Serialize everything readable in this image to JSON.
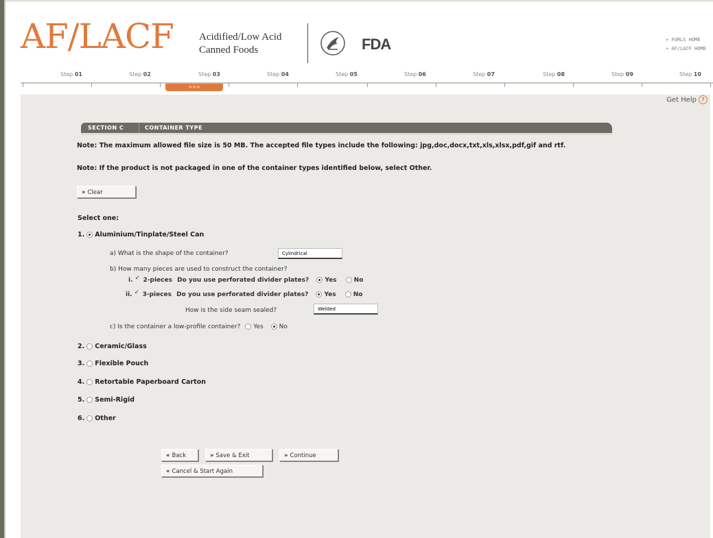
{
  "header": {
    "logo": "AF/LACF",
    "subtitle_line1": "Acidified/Low Acid",
    "subtitle_line2": "Canned Foods",
    "fda_logo": "FDA",
    "link_furls": "» FURLS HOME",
    "link_aflacf": "» AF/LACF HOME"
  },
  "steps": {
    "prefix": "Step",
    "numbers": [
      "01",
      "02",
      "03",
      "04",
      "05",
      "06",
      "07",
      "08",
      "09",
      "10"
    ],
    "current_marker": ">>>"
  },
  "help": {
    "label": "Get Help",
    "icon_glyph": "?"
  },
  "section": {
    "label": "SECTION C",
    "title": "CONTAINER TYPE"
  },
  "notes": {
    "note1": "Note: The maximum allowed file size is 50 MB. The accepted file types include the following: jpg,doc,docx,txt,xls,xlsx,pdf,gif and rtf.",
    "note2": "Note: If the product is not packaged in one of the container types identified below, select Other."
  },
  "buttons": {
    "clear": "Clear",
    "back": "Back",
    "save_exit": "Save & Exit",
    "continue": "Continue",
    "cancel": "Cancel & Start Again"
  },
  "form": {
    "select_one": "Select one:",
    "options": [
      {
        "num": "1.",
        "label": "Aluminium/Tinplate/Steel Can",
        "selected": true
      },
      {
        "num": "2.",
        "label": "Ceramic/Glass",
        "selected": false
      },
      {
        "num": "3.",
        "label": "Flexible Pouch",
        "selected": false
      },
      {
        "num": "4.",
        "label": "Retortable Paperboard Carton",
        "selected": false
      },
      {
        "num": "5.",
        "label": "Semi-Rigid",
        "selected": false
      },
      {
        "num": "6.",
        "label": "Other",
        "selected": false
      }
    ],
    "q_a": "a) What is the shape of the container?",
    "shape_value": "Cylindrical",
    "q_b": "b) How many pieces are used to construct the container?",
    "b_i_prefix": "i.",
    "b_i_label": "2-pieces",
    "b_ii_prefix": "ii.",
    "b_ii_label": "3-pieces",
    "divider_q": "Do you use perforated divider plates?",
    "yes": "Yes",
    "no": "No",
    "seam_q": "How is the side seam sealed?",
    "seam_value": "Welded",
    "q_c": "c) Is the container a low-profile container?"
  },
  "colors": {
    "accent": "#e07a3c",
    "panel": "#ebeae6",
    "tab": "#6c6c65"
  }
}
